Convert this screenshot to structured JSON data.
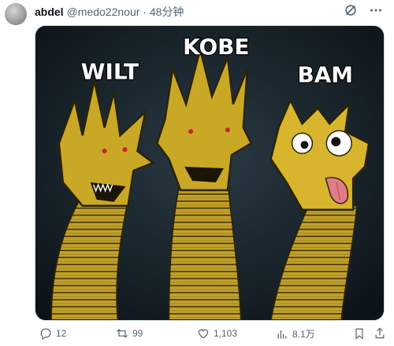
{
  "tweet": {
    "author_name": "abdel",
    "handle_and_time": "@medo22nour · 48分钟",
    "meme_labels": [
      "WILT",
      "KOBE",
      "BAM"
    ],
    "stats": {
      "replies": "12",
      "retweets": "99",
      "likes": "1,103",
      "views": "8.1万"
    }
  },
  "colors": {
    "dragon_gold": "#c9a825",
    "background": "#121c22",
    "text_muted": "#536471"
  }
}
